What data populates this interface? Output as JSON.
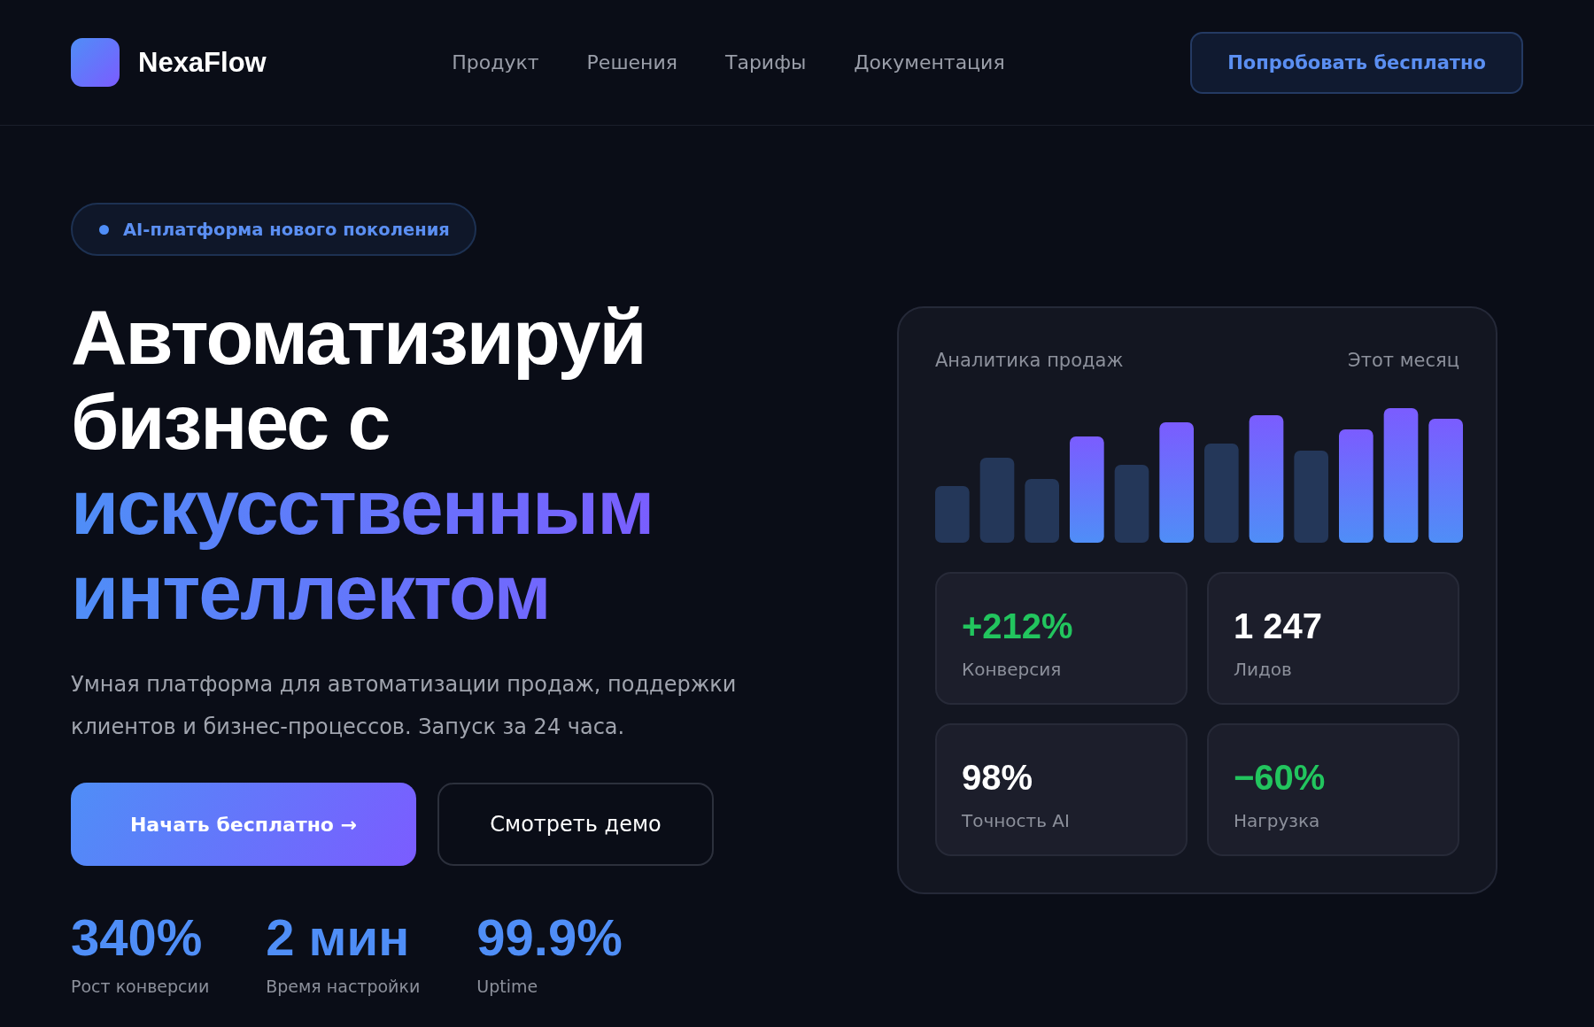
{
  "header": {
    "logo": "NexaFlow",
    "nav": [
      "Продукт",
      "Решения",
      "Тарифы",
      "Документация"
    ],
    "cta": "Попробовать бесплатно"
  },
  "hero": {
    "badge": "AI-платформа нового поколения",
    "title": "Автоматизируй бизнес с",
    "title_highlight": "искусственным интеллектом",
    "description": "Умная платформа для автоматизации продаж, поддержки клиентов и бизнес-процессов. Запуск за 24 часа.",
    "buttons": [
      {
        "kind": "primary",
        "label": "Начать бесплатно →"
      },
      {
        "kind": "secondary",
        "label": "Смотреть демо"
      }
    ],
    "stats": [
      {
        "value": "340%",
        "label": "Рост конверсии"
      },
      {
        "value": "2 мин",
        "label": "Время настройки"
      },
      {
        "value": "99.9%",
        "label": "Uptime"
      }
    ]
  },
  "analytics_card": {
    "title": "Аналитика продаж",
    "period": "Этот месяц",
    "metrics": [
      {
        "value": "+212%",
        "label": "Конверсия",
        "color": "#22c55e"
      },
      {
        "value": "1 247",
        "label": "Лидов",
        "color": "#ffffff"
      },
      {
        "value": "98%",
        "label": "Точность AI",
        "color": "#ffffff"
      },
      {
        "value": "−60%",
        "label": "Нагрузка",
        "color": "#22c55e"
      }
    ]
  }
}
